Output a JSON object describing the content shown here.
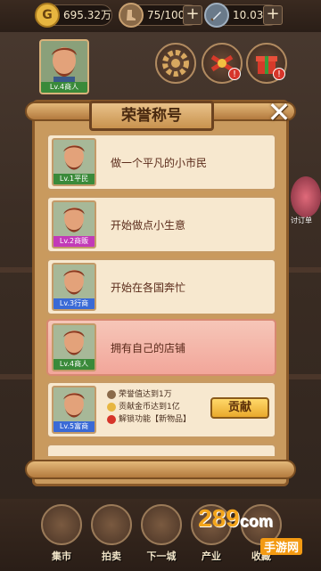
{
  "resources": [
    {
      "icon": "gold-coin-icon",
      "symbol": "G",
      "value": "695.32万",
      "plus": "+"
    },
    {
      "icon": "boot-stamina-icon",
      "symbol": "",
      "value": "75/100",
      "plus": "+"
    },
    {
      "icon": "sword-icon",
      "symbol": "",
      "value": "10.03万",
      "plus": "+"
    }
  ],
  "player": {
    "level_label": "Lv.4商人"
  },
  "popup": {
    "title": "荣誉称号",
    "close": "✕",
    "titles": [
      {
        "level": "Lv.1平民",
        "name": "做一个平凡的小市民",
        "lv_color": "#3a8a3a"
      },
      {
        "level": "Lv.2商贩",
        "name": "开始做点小生意",
        "lv_color": "#c23ab8"
      },
      {
        "level": "Lv.3行商",
        "name": "开始在各国奔忙",
        "lv_color": "#3a6ad6"
      },
      {
        "level": "Lv.4商人",
        "name": "拥有自己的店铺",
        "lv_color": "#3a8a3a"
      }
    ],
    "next": {
      "level": "Lv.5富商",
      "lv_color": "#3a6ad6",
      "requirements": [
        {
          "icon": "honor-icon",
          "text": "荣誉值达到1万"
        },
        {
          "icon": "coin-icon",
          "text": "贡献金币达到1亿"
        },
        {
          "icon": "unlock-icon",
          "text": "解锁功能【新物品】"
        }
      ],
      "button": "贡献"
    }
  },
  "side_label": "讨订单",
  "bottom_nav": [
    {
      "label": "集市",
      "icon": "market-icon"
    },
    {
      "label": "拍卖",
      "icon": "auction-hammer-icon"
    },
    {
      "label": "下一城",
      "icon": "next-city-icon"
    },
    {
      "label": "产业",
      "icon": "industry-icon"
    },
    {
      "label": "收藏",
      "icon": "collection-icon"
    }
  ],
  "watermark": {
    "brand": "289",
    "suffix": "com",
    "sub": "手游网"
  }
}
